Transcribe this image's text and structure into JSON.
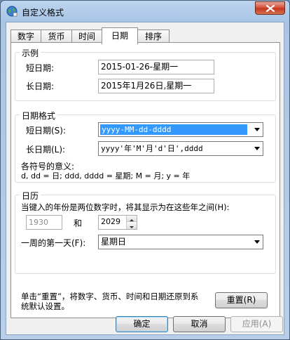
{
  "window": {
    "title": "自定义格式"
  },
  "tabs": [
    {
      "label": "数字"
    },
    {
      "label": "货币"
    },
    {
      "label": "时间"
    },
    {
      "label": "日期"
    },
    {
      "label": "排序"
    }
  ],
  "example": {
    "legend": "示例",
    "short_label": "短日期:",
    "short_value": "2015-01-26-星期一",
    "long_label": "长日期:",
    "long_value": "2015年1月26日,星期一"
  },
  "formats": {
    "legend": "日期格式",
    "short_label": "短日期(S):",
    "short_value": "yyyy-MM-dd-dddd",
    "long_label": "长日期(L):",
    "long_value": "yyyy'年'M'月'd'日',dddd",
    "symbols_title": "各符号的意义:",
    "symbols_text": "d, dd = 日;  ddd, dddd = 星期;  M = 月;  y = 年"
  },
  "calendar": {
    "legend": "日历",
    "two_digit_text": "当键入的年份是两位数字时，将其显示为在这些年之间(H):",
    "year_from": "1930",
    "and_label": "和",
    "year_to": "2029",
    "first_day_label": "一周的第一天(F):",
    "first_day_value": "星期日"
  },
  "reset": {
    "text_line1": "单击“重置”，将数字、货币、时间和日期还原到系",
    "text_line2": "统默认设置。",
    "button": "重置(R)"
  },
  "footer": {
    "ok": "确定",
    "cancel": "取消",
    "apply": "应用(A)"
  }
}
